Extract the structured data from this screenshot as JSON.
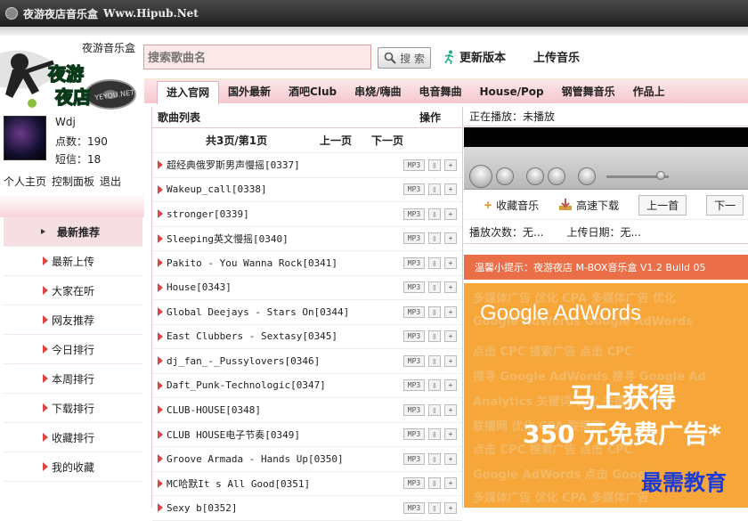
{
  "titlebar": {
    "title": "夜游夜店音乐盒",
    "url": "Www.Hipub.Net"
  },
  "brand": {
    "name": "夜游音乐盒",
    "logo_text_1": "夜游",
    "logo_text_2": "夜店",
    "logo_badge": "YEYOU.NET"
  },
  "search": {
    "placeholder": "搜索歌曲名",
    "button_label": "搜 索"
  },
  "toplinks": {
    "update": "更新版本",
    "upload": "上传音乐"
  },
  "nav": {
    "items": [
      "进入官网",
      "国外最新",
      "酒吧Club",
      "串烧/嗨曲",
      "电音舞曲",
      "House/Pop",
      "钢管舞音乐",
      "作品上"
    ]
  },
  "user": {
    "name": "Wdj",
    "points": "点数：190",
    "messages": "短信：18",
    "links": [
      "个人主页",
      "控制面板",
      "退出"
    ]
  },
  "sidebar": {
    "items": [
      "最新推荐",
      "最新上传",
      "大家在听",
      "网友推荐",
      "今日排行",
      "本周排行",
      "下载排行",
      "收藏排行",
      "我的收藏"
    ]
  },
  "songlist": {
    "header_title": "歌曲列表",
    "header_ops": "操作",
    "page_info": "共3页/第1页",
    "prev": "上一页",
    "next": "下一页",
    "mp3_label": "MP3",
    "songs": [
      "超经典俄罗斯男声慢摇[0337]",
      "Wakeup_call[0338]",
      "stronger[0339]",
      "Sleeping英文慢摇[0340]",
      "Pakito - You Wanna Rock[0341]",
      "House[0343]",
      "Global Deejays - Stars On[0344]",
      "East Clubbers - Sextasy[0345]",
      "dj_fan_-_Pussylovers[0346]",
      "Daft_Punk-Technologic[0347]",
      "CLUB-HOUSE[0348]",
      "CLUB HOUSE电子节奏[0349]",
      "Groove Armada - Hands Up[0350]",
      "MC哈默It s All Good[0351]",
      "Sexy b[0352]"
    ]
  },
  "player": {
    "now_playing": "正在播放：未播放",
    "collect": "收藏音乐",
    "download": "高速下载",
    "prev": "上一首",
    "next": "下一",
    "play_count": "播放次数：无...",
    "upload_date": "上传日期：无..."
  },
  "tip": "温馨小提示：夜游夜店 M-BOX音乐盒 V1.2 Build 05",
  "ad": {
    "brand": "Google AdWords",
    "line1": "马上获得",
    "line2": "350 元免费广告*",
    "bg_rows": [
      "多媒体广告  优化  CPA  多媒体广告  优化",
      "Google AdWords   Google AdWords",
      "点击  CPC  搜索广告  点击  CPC",
      "搜寻  Google AdWords  搜寻  Google Ad",
      "Analytics  关键词  优化  关键词",
      "联播网  优化  CPA  联播网",
      "点击  CPC  搜索广告  点击  CPC",
      "Google AdWords  点击  Google",
      "多媒体广告  优化  CPA  多媒体广告"
    ],
    "colors": {
      "bg": "#f7a63a",
      "tip": "#ea6f48"
    }
  },
  "watermark": "最需教育"
}
